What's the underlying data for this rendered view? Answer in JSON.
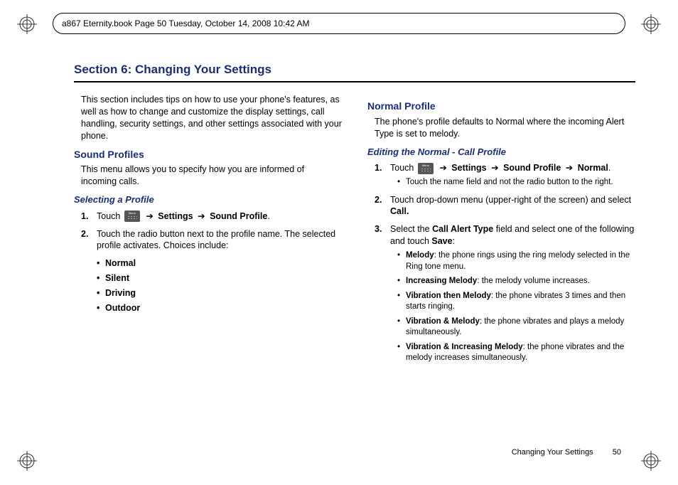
{
  "header": {
    "text": "a867 Eternity.book  Page 50  Tuesday, October 14, 2008  10:42 AM"
  },
  "section": {
    "title": "Section 6: Changing Your Settings",
    "intro": "This section includes tips on how to use your phone's features, as well as how to change and customize the display settings, call handling, security settings, and other settings associated with your phone."
  },
  "sound_profiles": {
    "heading": "Sound Profiles",
    "intro": "This menu allows you to specify how you are informed of incoming calls.",
    "selecting": {
      "heading": "Selecting a Profile",
      "steps": [
        {
          "pre": "Touch ",
          "path_settings": "Settings",
          "path_sound": "Sound Profile",
          "post": "."
        },
        {
          "text": "Touch the radio button next to the profile name. The selected profile activates. Choices include:"
        }
      ],
      "choices": [
        "Normal",
        "Silent",
        "Driving",
        "Outdoor"
      ]
    }
  },
  "normal_profile": {
    "heading": "Normal Profile",
    "intro": "The phone's profile defaults to Normal where the incoming Alert Type is set to melody.",
    "editing": {
      "heading": "Editing the Normal - Call Profile",
      "step1": {
        "pre": "Touch ",
        "settings": "Settings",
        "sound": "Sound Profile",
        "normal": "Normal",
        "post": ".",
        "note": "Touch the name field and not the radio button to the right."
      },
      "step2": {
        "text_a": "Touch drop-down menu (upper-right of the screen) and select ",
        "call": "Call."
      },
      "step3": {
        "text_a": "Select the ",
        "call_alert": "Call Alert Type",
        "text_b": " field and select one of the following and touch ",
        "save": "Save",
        "text_c": ":"
      },
      "options": [
        {
          "name": "Melody",
          "desc": ": the phone rings using the ring melody selected in the Ring tone menu."
        },
        {
          "name": "Increasing Melody",
          "desc": ": the melody volume increases."
        },
        {
          "name": "Vibration then Melody",
          "desc": ": the phone vibrates 3 times and then starts ringing."
        },
        {
          "name": "Vibration & Melody",
          "desc": ": the phone vibrates and plays a melody simultaneously."
        },
        {
          "name": "Vibration & Increasing Melody",
          "desc": ": the phone vibrates and the melody increases simultaneously."
        }
      ]
    }
  },
  "footer": {
    "label": "Changing Your Settings",
    "page": "50"
  },
  "arrow": "➔"
}
